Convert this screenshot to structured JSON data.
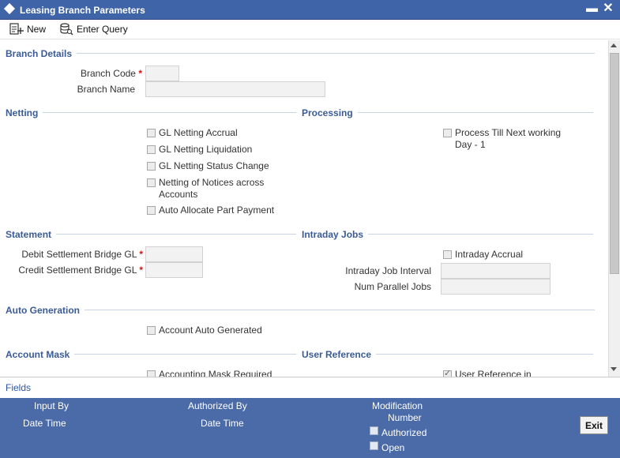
{
  "window": {
    "title": "Leasing Branch Parameters",
    "minimize": "▬",
    "close": "✕"
  },
  "toolbar": {
    "new_label": "New",
    "enter_query_label": "Enter Query"
  },
  "branch_details": {
    "section": "Branch Details",
    "branch_code_label": "Branch Code",
    "branch_name_label": "Branch Name",
    "branch_code_value": "",
    "branch_name_value": ""
  },
  "netting": {
    "section": "Netting",
    "items": [
      {
        "label": "GL Netting Accrual",
        "checked": false
      },
      {
        "label": "GL Netting Liquidation",
        "checked": false
      },
      {
        "label": "GL Netting Status Change",
        "checked": false
      },
      {
        "label": "Netting of Notices across Accounts",
        "checked": false
      },
      {
        "label": "Auto Allocate Part Payment",
        "checked": false
      }
    ]
  },
  "processing": {
    "section": "Processing",
    "process_till_label": "Process Till Next working Day - 1",
    "checked": false
  },
  "statement": {
    "section": "Statement",
    "debit_label": "Debit Settlement Bridge GL",
    "credit_label": "Credit Settlement Bridge GL",
    "debit_value": "",
    "credit_value": ""
  },
  "intraday": {
    "section": "Intraday Jobs",
    "accrual_label": "Intraday Accrual",
    "interval_label": "Intraday Job Interval",
    "parallel_label": "Num Parallel Jobs",
    "interval_value": "",
    "parallel_value": ""
  },
  "auto_generation": {
    "section": "Auto Generation",
    "account_auto_label": "Account Auto Generated"
  },
  "account_mask": {
    "section": "Account Mask",
    "mask_required_label": "Accounting Mask Required"
  },
  "user_reference": {
    "section": "User Reference",
    "user_ref_label": "User Reference in",
    "checked": true
  },
  "required_mark": "*",
  "fields_link": "Fields",
  "footer": {
    "input_by": "Input By",
    "date_time_1": "Date Time",
    "authorized_by": "Authorized By",
    "date_time_2": "Date Time",
    "modification_1": "Modification",
    "modification_2": "Number",
    "authorized": "Authorized",
    "open": "Open",
    "exit": "Exit"
  },
  "colors": {
    "titlebar": "#3f64a8",
    "section": "#3a5b96",
    "footer": "#4a6ba8",
    "required": "#dd1111"
  }
}
